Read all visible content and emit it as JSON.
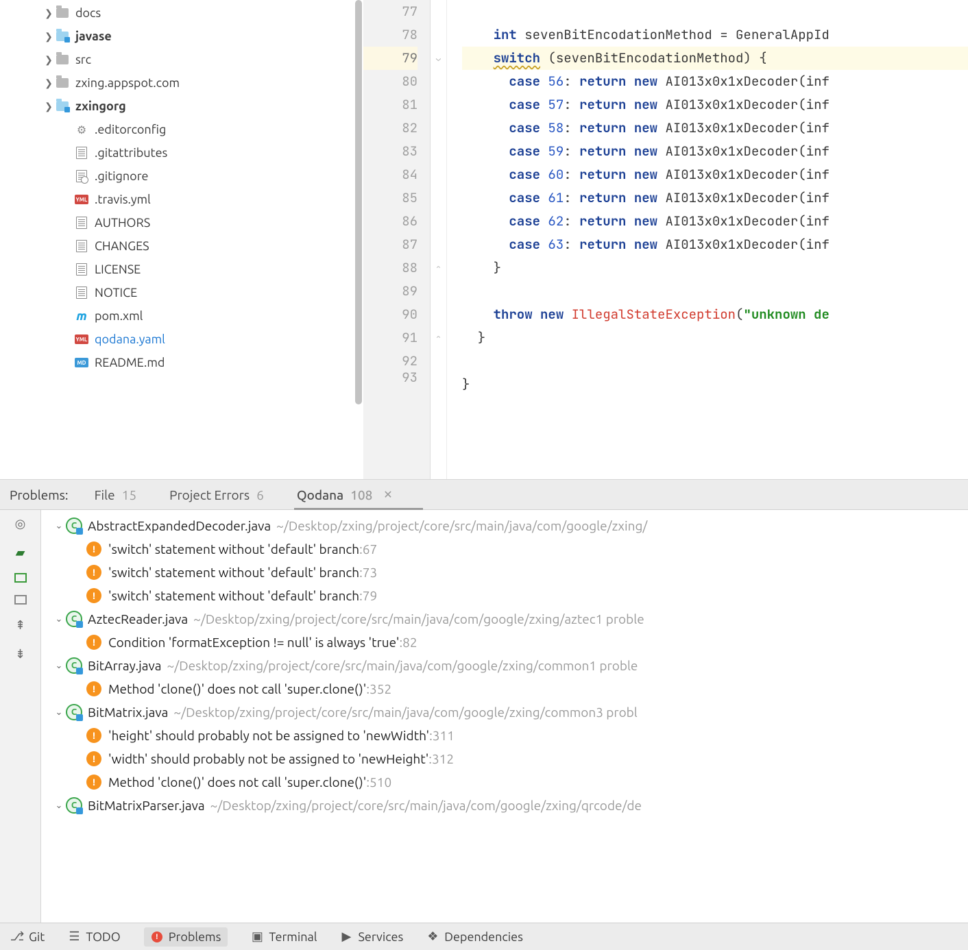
{
  "project_tree": [
    {
      "indent": 62,
      "chevron": true,
      "icon": "folder",
      "label": "docs",
      "bold": false
    },
    {
      "indent": 62,
      "chevron": true,
      "icon": "folder-mod",
      "label": "javase",
      "bold": true
    },
    {
      "indent": 62,
      "chevron": true,
      "icon": "folder",
      "label": "src",
      "bold": false
    },
    {
      "indent": 62,
      "chevron": true,
      "icon": "folder",
      "label": "zxing.appspot.com",
      "bold": false
    },
    {
      "indent": 62,
      "chevron": true,
      "icon": "folder-mod",
      "label": "zxingorg",
      "bold": true
    },
    {
      "indent": 90,
      "chevron": false,
      "icon": "gear",
      "label": ".editorconfig"
    },
    {
      "indent": 90,
      "chevron": false,
      "icon": "file",
      "label": ".gitattributes"
    },
    {
      "indent": 90,
      "chevron": false,
      "icon": "file-ignore",
      "label": ".gitignore"
    },
    {
      "indent": 90,
      "chevron": false,
      "icon": "yaml",
      "label": ".travis.yml"
    },
    {
      "indent": 90,
      "chevron": false,
      "icon": "file",
      "label": "AUTHORS"
    },
    {
      "indent": 90,
      "chevron": false,
      "icon": "file",
      "label": "CHANGES"
    },
    {
      "indent": 90,
      "chevron": false,
      "icon": "file",
      "label": "LICENSE"
    },
    {
      "indent": 90,
      "chevron": false,
      "icon": "file",
      "label": "NOTICE"
    },
    {
      "indent": 90,
      "chevron": false,
      "icon": "m",
      "label": "pom.xml"
    },
    {
      "indent": 90,
      "chevron": false,
      "icon": "yaml",
      "label": "qodana.yaml",
      "link": true
    },
    {
      "indent": 90,
      "chevron": false,
      "icon": "md",
      "label": "README.md"
    }
  ],
  "editor": {
    "lines": [
      {
        "n": 77,
        "html": ""
      },
      {
        "n": 78,
        "html": "<span class='tk-kw'>int</span> sevenBitEncodationMethod = GeneralAppId"
      },
      {
        "n": 79,
        "current": true,
        "fold": "down",
        "html": "<span class='tk-kw tk-wave'>switch</span> (sevenBitEncodationMethod) {"
      },
      {
        "n": 80,
        "html": "  <span class='tk-kw'>case</span> <span class='tk-num'>56</span>: <span class='tk-kw'>return</span> <span class='tk-kw'>new</span> AI013x0x1xDecoder(inf"
      },
      {
        "n": 81,
        "html": "  <span class='tk-kw'>case</span> <span class='tk-num'>57</span>: <span class='tk-kw'>return</span> <span class='tk-kw'>new</span> AI013x0x1xDecoder(inf"
      },
      {
        "n": 82,
        "html": "  <span class='tk-kw'>case</span> <span class='tk-num'>58</span>: <span class='tk-kw'>return</span> <span class='tk-kw'>new</span> AI013x0x1xDecoder(inf"
      },
      {
        "n": 83,
        "html": "  <span class='tk-kw'>case</span> <span class='tk-num'>59</span>: <span class='tk-kw'>return</span> <span class='tk-kw'>new</span> AI013x0x1xDecoder(inf"
      },
      {
        "n": 84,
        "html": "  <span class='tk-kw'>case</span> <span class='tk-num'>60</span>: <span class='tk-kw'>return</span> <span class='tk-kw'>new</span> AI013x0x1xDecoder(inf"
      },
      {
        "n": 85,
        "html": "  <span class='tk-kw'>case</span> <span class='tk-num'>61</span>: <span class='tk-kw'>return</span> <span class='tk-kw'>new</span> AI013x0x1xDecoder(inf"
      },
      {
        "n": 86,
        "html": "  <span class='tk-kw'>case</span> <span class='tk-num'>62</span>: <span class='tk-kw'>return</span> <span class='tk-kw'>new</span> AI013x0x1xDecoder(inf"
      },
      {
        "n": 87,
        "html": "  <span class='tk-kw'>case</span> <span class='tk-num'>63</span>: <span class='tk-kw'>return</span> <span class='tk-kw'>new</span> AI013x0x1xDecoder(inf"
      },
      {
        "n": 88,
        "fold": "up",
        "html": "}"
      },
      {
        "n": 89,
        "html": ""
      },
      {
        "n": 90,
        "html": "<span class='tk-kw'>throw</span> <span class='tk-kw'>new</span> <span class='tk-err'>IllegalStateException</span>(<span class='tk-str'>\"unknown de</span>"
      },
      {
        "n": 91,
        "fold": "up",
        "html": "}",
        "outdent": 1
      },
      {
        "n": 92,
        "html": ""
      },
      {
        "n": 93,
        "partial": true,
        "html": "}",
        "outdent": 2
      }
    ],
    "base_indent": "    "
  },
  "problems_header": {
    "label": "Problems:",
    "tabs": [
      {
        "label": "File",
        "count": "15"
      },
      {
        "label": "Project Errors",
        "count": "6"
      },
      {
        "label": "Qodana",
        "count": "108",
        "active": true,
        "closeable": true
      }
    ]
  },
  "problems_tree": [
    {
      "type": "file",
      "name": "AbstractExpandedDecoder.java",
      "path": "~/Desktop/zxing/project/core/src/main/java/com/google/zxing/",
      "count": ""
    },
    {
      "type": "msg",
      "text": "'switch' statement without 'default' branch",
      "line": ":67"
    },
    {
      "type": "msg",
      "text": "'switch' statement without 'default' branch",
      "line": ":73"
    },
    {
      "type": "msg",
      "text": "'switch' statement without 'default' branch",
      "line": ":79"
    },
    {
      "type": "file",
      "name": "AztecReader.java",
      "path": "~/Desktop/zxing/project/core/src/main/java/com/google/zxing/aztec",
      "count": "1 proble"
    },
    {
      "type": "msg",
      "text": "Condition 'formatException != null' is always 'true'",
      "line": ":82"
    },
    {
      "type": "file",
      "name": "BitArray.java",
      "path": "~/Desktop/zxing/project/core/src/main/java/com/google/zxing/common",
      "count": "1 proble"
    },
    {
      "type": "msg",
      "text": "Method 'clone()' does not call 'super.clone()'",
      "line": ":352"
    },
    {
      "type": "file",
      "name": "BitMatrix.java",
      "path": "~/Desktop/zxing/project/core/src/main/java/com/google/zxing/common",
      "count": "3 probl"
    },
    {
      "type": "msg",
      "text": "'height' should probably not be assigned to 'newWidth'",
      "line": ":311"
    },
    {
      "type": "msg",
      "text": "'width' should probably not be assigned to 'newHeight'",
      "line": ":312"
    },
    {
      "type": "msg",
      "text": "Method 'clone()' does not call 'super.clone()'",
      "line": ":510"
    },
    {
      "type": "file",
      "name": "BitMatrixParser.java",
      "path": "~/Desktop/zxing/project/core/src/main/java/com/google/zxing/qrcode/de",
      "count": ""
    }
  ],
  "bottom_tabs": [
    {
      "icon": "git",
      "label": "Git"
    },
    {
      "icon": "todo",
      "label": "TODO"
    },
    {
      "icon": "error",
      "label": "Problems",
      "active": true
    },
    {
      "icon": "terminal",
      "label": "Terminal"
    },
    {
      "icon": "services",
      "label": "Services"
    },
    {
      "icon": "deps",
      "label": "Dependencies"
    }
  ],
  "icons_text": {
    "yaml": "YML",
    "md": "MD"
  }
}
